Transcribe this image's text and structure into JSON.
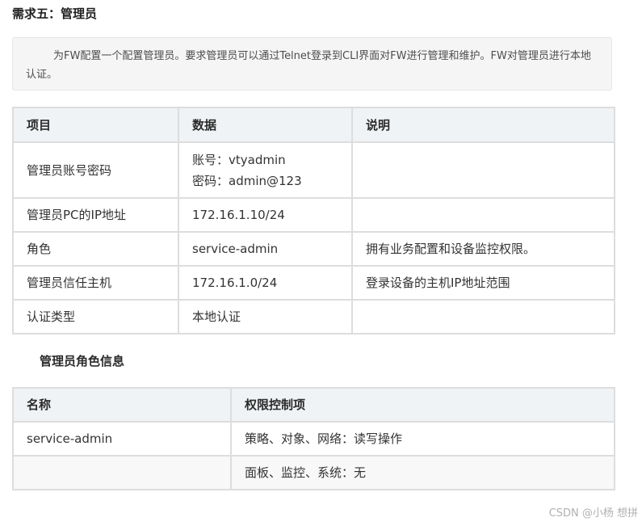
{
  "heading": "需求五：管理员",
  "note": "为FW配置一个配置管理员。要求管理员可以通过Telnet登录到CLI界面对FW进行管理和维护。FW对管理员进行本地认证。",
  "table1": {
    "headers": [
      "项目",
      "数据",
      "说明"
    ],
    "rows": [
      {
        "item": "管理员账号密码",
        "data_line1": "账号：vtyadmin",
        "data_line2": "密码：admin@123",
        "desc": ""
      },
      {
        "item": "管理员PC的IP地址",
        "data": "172.16.1.10/24",
        "desc": ""
      },
      {
        "item": "角色",
        "data": "service-admin",
        "desc": "拥有业务配置和设备监控权限。"
      },
      {
        "item": "管理员信任主机",
        "data": "172.16.1.0/24",
        "desc": "登录设备的主机IP地址范围"
      },
      {
        "item": "认证类型",
        "data": "本地认证",
        "desc": ""
      }
    ]
  },
  "subheading": "管理员角色信息",
  "table2": {
    "headers": [
      "名称",
      "权限控制项"
    ],
    "rows": [
      {
        "name": "service-admin",
        "perm": "策略、对象、网络：读写操作"
      },
      {
        "name": "",
        "perm": "面板、监控、系统：无"
      }
    ]
  },
  "watermark": "CSDN @小杨 想拼"
}
